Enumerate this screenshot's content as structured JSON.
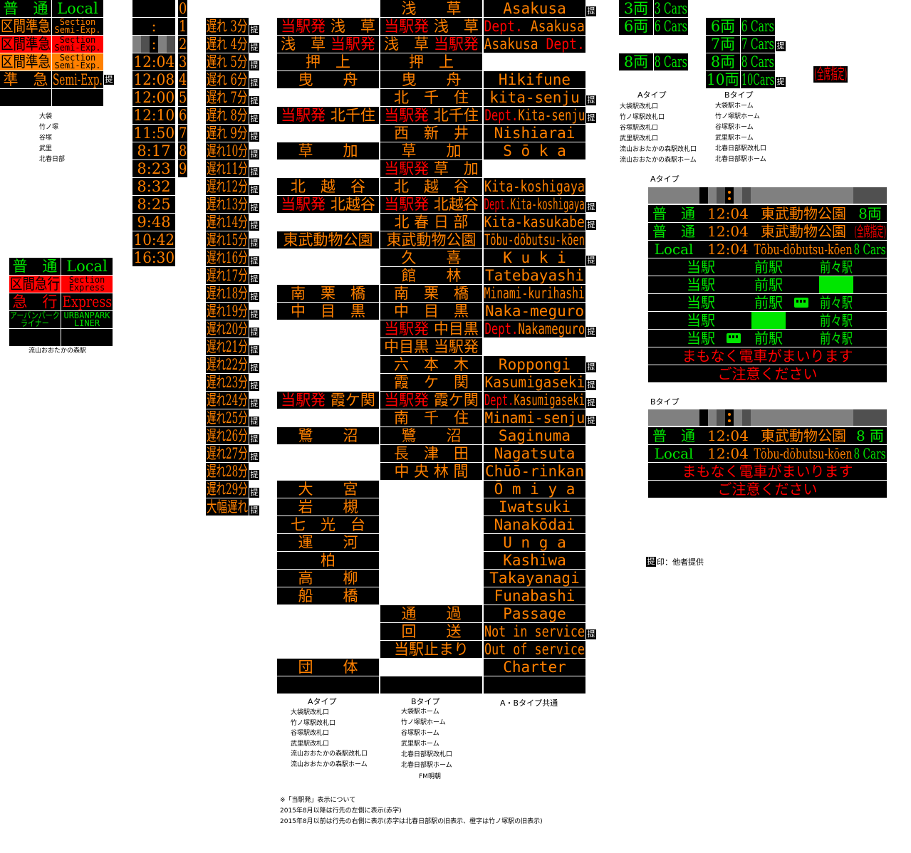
{
  "colors": {
    "orange": "#ff8000",
    "green": "#00e600",
    "red": "#ff0000",
    "grey": "#808080",
    "dark_grey": "#505050",
    "panel": "#000000"
  },
  "mark": "提",
  "train_types": {
    "rows": [
      {
        "jp": "普　通",
        "en": "Local",
        "fg": "g"
      },
      {
        "jp": "区間準急",
        "en": "Section",
        "en2": "Semi-Exp.",
        "fg": "o"
      },
      {
        "jp": "区間準急",
        "en": "Section",
        "en2": "Semi-Exp.",
        "fg": "k",
        "bg": "#ff0000"
      },
      {
        "jp": "区間準急",
        "en": "Section",
        "en2": "Semi-Exp.",
        "fg": "k",
        "bg": "#ff8000"
      },
      {
        "jp": "準　急",
        "en": "Semi-Exp.",
        "fg": "o",
        "mark": true
      },
      {
        "jp": "",
        "en": "",
        "fg": "o"
      }
    ],
    "stations": [
      "大袋",
      "竹ノ塚",
      "谷塚",
      "武里",
      "北春日部"
    ]
  },
  "train_types_2": {
    "rows": [
      {
        "jp": "普　通",
        "en": "Local",
        "fg": "g"
      },
      {
        "jp": "区間急行",
        "en": "Section",
        "en2": "Express",
        "fg": "k",
        "bg": "#ff0000"
      },
      {
        "jp": "急　行",
        "en": "Express",
        "fg": "r"
      },
      {
        "jp": "アーバンパーク",
        "jp2": "ライナー",
        "en": "URBANPARK",
        "en2": "LINER",
        "fg": "g"
      },
      {
        "jp": "",
        "en": "",
        "fg": "g"
      }
    ],
    "station": "流山おおたかの森駅"
  },
  "times": [
    "",
    ":",
    ":",
    "12:04",
    "12:08",
    "12:00",
    "12:10",
    "11:50",
    "8:17",
    "8:23",
    "8:32",
    "8:25",
    "9:48",
    "10:42",
    "16:30"
  ],
  "digits": [
    "0",
    "1",
    "2",
    "3",
    "4",
    "5",
    "6",
    "7",
    "8",
    "9"
  ],
  "delays": [
    "遅れ 3分",
    "遅れ 4分",
    "遅れ 5分",
    "遅れ 6分",
    "遅れ 7分",
    "遅れ 8分",
    "遅れ 9分",
    "遅れ10分",
    "遅れ11分",
    "遅れ12分",
    "遅れ13分",
    "遅れ14分",
    "遅れ15分",
    "遅れ16分",
    "遅れ17分",
    "遅れ18分",
    "遅れ19分",
    "遅れ20分",
    "遅れ21分",
    "遅れ22分",
    "遅れ23分",
    "遅れ24分",
    "遅れ25分",
    "遅れ26分",
    "遅れ27分",
    "遅れ28分",
    "遅れ29分",
    "大幅遅れ"
  ],
  "destinations": {
    "rows": [
      {
        "a": null,
        "b": "浅　　草",
        "en": "Asakusa",
        "mark": true
      },
      {
        "a": [
          {
            "t": "当駅発 ",
            "c": "r"
          },
          {
            "t": "浅　草",
            "c": "o"
          }
        ],
        "b": [
          {
            "t": "当駅発 ",
            "c": "r"
          },
          {
            "t": "浅　草",
            "c": "o"
          }
        ],
        "en": [
          {
            "t": "Dept. ",
            "c": "r"
          },
          {
            "t": "Asakusa",
            "c": "o"
          }
        ]
      },
      {
        "a": [
          {
            "t": "浅　草 ",
            "c": "o"
          },
          {
            "t": "当駅発",
            "c": "r"
          }
        ],
        "b": [
          {
            "t": "浅　草 ",
            "c": "o"
          },
          {
            "t": "当駅発",
            "c": "r"
          }
        ],
        "en": [
          {
            "t": "Asakusa ",
            "c": "o"
          },
          {
            "t": "Dept.",
            "c": "r"
          }
        ]
      },
      {
        "a": "押　上",
        "b": "押　上",
        "en": null
      },
      {
        "a": "曳　　舟",
        "b": "曳　　舟",
        "en": "Hikifune"
      },
      {
        "a": null,
        "b": "北　千　住",
        "en": "kita-senju",
        "mark": true
      },
      {
        "a": [
          {
            "t": "当駅発 ",
            "c": "r"
          },
          {
            "t": "北千住",
            "c": "o"
          }
        ],
        "b": [
          {
            "t": "当駅発 ",
            "c": "r"
          },
          {
            "t": "北千住",
            "c": "o"
          }
        ],
        "en": [
          {
            "t": "Dept.",
            "c": "r"
          },
          {
            "t": "Kita-senju",
            "c": "o"
          }
        ],
        "mark": true
      },
      {
        "a": null,
        "b": "西　新　井",
        "en": "Nishiarai"
      },
      {
        "a": "草　　加",
        "b": "草　　加",
        "en": "S ō k a"
      },
      {
        "a": null,
        "b": [
          {
            "t": "当駅発 ",
            "c": "r"
          },
          {
            "t": "草　加",
            "c": "o"
          }
        ],
        "en": null
      },
      {
        "a": "北　越　谷",
        "b": "北　越　谷",
        "en": "Kita-koshigaya"
      },
      {
        "a": [
          {
            "t": "当駅発 ",
            "c": "r"
          },
          {
            "t": "北越谷",
            "c": "o"
          }
        ],
        "b": [
          {
            "t": "当駅発 ",
            "c": "r"
          },
          {
            "t": "北越谷",
            "c": "o"
          }
        ],
        "en": [
          {
            "t": "Dept.",
            "c": "r"
          },
          {
            "t": "Kita-koshigaya",
            "c": "o"
          }
        ],
        "mark": true
      },
      {
        "a": null,
        "b": "北 春 日 部",
        "en": "Kita-kasukabe",
        "mark": true
      },
      {
        "a": "東武動物公園",
        "b": "東武動物公園",
        "en": "Tōbu-dōbutsu-kōen"
      },
      {
        "a": null,
        "b": "久　　喜",
        "en": "K u k i",
        "mark": true
      },
      {
        "a": null,
        "b": "館　　林",
        "en": "Tatebayashi"
      },
      {
        "a": "南　栗　橋",
        "b": "南　栗　橋",
        "en": "Minami-kurihashi"
      },
      {
        "a": "中　目　黒",
        "b": "中　目　黒",
        "en": "Naka-meguro"
      },
      {
        "a": null,
        "b": [
          {
            "t": "当駅発 ",
            "c": "r"
          },
          {
            "t": "中目黒",
            "c": "o"
          }
        ],
        "en": [
          {
            "t": "Dept.",
            "c": "r"
          },
          {
            "t": "Nakameguro",
            "c": "o"
          }
        ],
        "mark": true
      },
      {
        "a": null,
        "b": "中目黒 当駅発",
        "en": null
      },
      {
        "a": null,
        "b": "六　本　木",
        "en": "Roppongi",
        "mark": true
      },
      {
        "a": null,
        "b": "霞　ケ　関",
        "en": "Kasumigaseki",
        "mark": true
      },
      {
        "a": [
          {
            "t": "当駅発 ",
            "c": "r"
          },
          {
            "t": "霞ケ関",
            "c": "o"
          }
        ],
        "b": [
          {
            "t": "当駅発 ",
            "c": "r"
          },
          {
            "t": "霞ケ関",
            "c": "o"
          }
        ],
        "en": [
          {
            "t": "Dept.",
            "c": "r"
          },
          {
            "t": "Kasumigaseki",
            "c": "o"
          }
        ],
        "mark": true
      },
      {
        "a": null,
        "b": "南　千　住",
        "en": "Minami-senju",
        "mark": true
      },
      {
        "a": "鷺　　沼",
        "b": "鷺　　沼",
        "en": "Saginuma"
      },
      {
        "a": null,
        "b": "長　津　田",
        "en": "Nagatsuta"
      },
      {
        "a": null,
        "b": "中 央 林 間",
        "en": "Chūō-rinkan"
      },
      {
        "a": "大　　宮",
        "b": null,
        "en": "Ō m i y a"
      },
      {
        "a": "岩　　槻",
        "b": null,
        "en": "Iwatsuki"
      },
      {
        "a": "七　光　台",
        "b": null,
        "en": "Nanakōdai"
      },
      {
        "a": "運　　河",
        "b": null,
        "en": "U n g a"
      },
      {
        "a": "柏",
        "b": null,
        "en": "Kashiwa"
      },
      {
        "a": "高　　柳",
        "b": null,
        "en": "Takayanagi"
      },
      {
        "a": "船　　橋",
        "b": null,
        "en": "Funabashi"
      },
      {
        "a": null,
        "b": "通　　過",
        "en": "Passage"
      },
      {
        "a": null,
        "b": "回　　送",
        "en": "Not in service",
        "mark": true
      },
      {
        "a": null,
        "b": "当駅止まり",
        "en": "Out of service"
      },
      {
        "a": "団　　体",
        "b": null,
        "en": "Charter"
      },
      {
        "a": "",
        "b": "",
        "en": ""
      }
    ],
    "labels": {
      "a": "Aタイプ",
      "b": "Bタイプ",
      "common": "A・Bタイプ共通"
    },
    "a_stations": [
      "大袋駅改札口",
      "竹ノ塚駅改札口",
      "谷塚駅改札口",
      "武里駅改札口",
      "流山おおたかの森駅改札口",
      "流山おおたかの森駅ホーム"
    ],
    "b_stations": [
      "大袋駅ホーム",
      "竹ノ塚駅ホーム",
      "谷塚駅ホーム",
      "武里駅ホーム",
      "北春日部駅改札口",
      "北春日部駅ホーム"
    ],
    "b_font": "FM明朝"
  },
  "notes": [
    "※「当駅発」表示について",
    "2015年8月以降は行先の左側に表示(赤字)",
    "2015年8月以前は行先の右側に表示(赤字は北春日部駅の旧表示、橙字は竹ノ塚駅の旧表示)"
  ],
  "cars": {
    "a_rows": [
      {
        "jp": "3両",
        "en": "3 Cars"
      },
      {
        "jp": "6両",
        "en": "6 Cars"
      },
      null,
      {
        "jp": "8両",
        "en": "8 Cars"
      }
    ],
    "b_rows": [
      {
        "jp": "6両",
        "en": "6 Cars"
      },
      {
        "jp": "7両",
        "en": "7 Cars",
        "mark": true
      },
      {
        "jp": "8両",
        "en": "8 Cars"
      },
      {
        "jp": "10両",
        "en": "10Cars",
        "mark": true
      }
    ],
    "reserved": "(全席指定)",
    "a_label": "Aタイプ",
    "b_label": "Bタイプ",
    "a_stations": [
      "大袋駅改札口",
      "竹ノ塚駅改札口",
      "谷塚駅改札口",
      "武里駅改札口",
      "流山おおたかの森駅改札口",
      "流山おおたかの森駅ホーム"
    ],
    "b_stations": [
      "大袋駅ホーム",
      "竹ノ塚駅ホーム",
      "谷塚駅ホーム",
      "武里駅ホーム",
      "北春日部駅改札口",
      "北春日部駅ホーム"
    ]
  },
  "display_a": {
    "label": "Aタイプ",
    "rows": [
      {
        "type": "普　通",
        "time": "12:04",
        "dest": "東武動物公園",
        "cars": "8両"
      },
      {
        "type": "普　通",
        "time": "12:04",
        "dest": "東武動物公園",
        "cars": "(全席指定)",
        "cars_color": "r"
      },
      {
        "type": "Local",
        "time": "12:04",
        "dest": "Tōbu-dōbutsu-kōen",
        "cars": "8 Cars"
      }
    ],
    "positions": {
      "here": "当駅",
      "prev": "前駅",
      "prev2": "前々駅"
    },
    "position_rows": [
      {
        "highlight": null,
        "train": null
      },
      {
        "highlight": "prev2",
        "train": null
      },
      {
        "highlight": null,
        "train": "between-prev-prev2"
      },
      {
        "highlight": "prev",
        "train": null
      },
      {
        "highlight": null,
        "train": "between-here-prev"
      }
    ],
    "messages": [
      "まもなく電車がまいります",
      "ご注意ください"
    ]
  },
  "display_b": {
    "label": "Bタイプ",
    "rows": [
      {
        "type": "普　通",
        "time": "12:04",
        "dest": "東武動物公園",
        "cars": "8 両"
      },
      {
        "type": "Local",
        "time": "12:04",
        "dest": "Tōbu-dōbutsu-kōen",
        "cars": "8 Cars"
      }
    ],
    "messages": [
      "まもなく電車がまいります",
      "ご注意ください"
    ]
  },
  "legend": {
    "mark": "提",
    "text": "印：他者提供"
  }
}
